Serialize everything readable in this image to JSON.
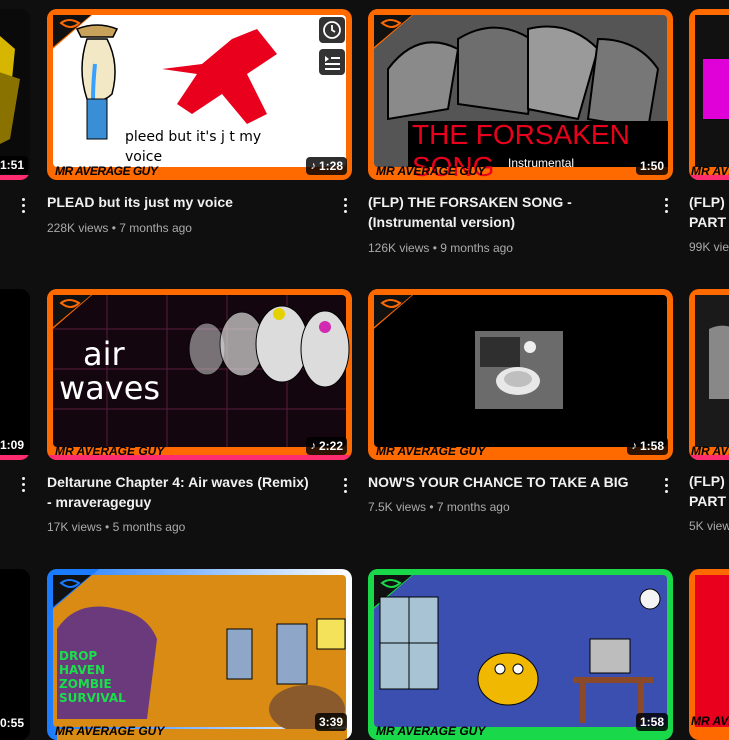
{
  "videos": [
    {
      "title": "PLEAD but its just my voice",
      "views": "228K views",
      "age": "7 months ago",
      "duration": "1:28",
      "thumb_text": "pleed but it's j t my voice",
      "channel_watermark": "MR AVERAGE GUY"
    },
    {
      "title": "(FLP) THE FORSAKEN SONG - (Instrumental version)",
      "views": "126K views",
      "age": "9 months ago",
      "duration": "1:50",
      "thumb_text": "THE FORSAKEN SONG",
      "thumb_sub": "Instrumental",
      "channel_watermark": "MR AVERAGE GUY"
    },
    {
      "title": "Deltarune Chapter 4: Air waves (Remix) - mraverageguy",
      "views": "17K views",
      "age": "5 months ago",
      "duration": "2:22",
      "thumb_text_1": "air",
      "thumb_text_2": "waves",
      "channel_watermark": "MR AVERAGE GUY"
    },
    {
      "title": "NOW'S YOUR CHANCE TO TAKE A BIG",
      "views": "7.5K views",
      "age": "7 months ago",
      "duration": "1:58",
      "channel_watermark": "MR AVERAGE GUY"
    },
    {
      "duration": "3:39",
      "thumb_text": "DROP HAVEN ZOMBIE SURVIVAL",
      "channel_watermark": "MR AVERAGE GUY"
    },
    {
      "duration": "1:58",
      "channel_watermark": "MR AVERAGE GUY"
    }
  ],
  "left_partial": {
    "durations": [
      "1:51",
      "1:09",
      "0:55"
    ]
  },
  "right_partial": {
    "rows": [
      {
        "title_1": "(FLP) r",
        "title_2": "PART :",
        "meta": "99K vie"
      },
      {
        "title_1": "(FLP) r",
        "title_2": "PART :",
        "meta": "5K view"
      }
    ],
    "watermark": "MR AVERAGE GU"
  },
  "separator": "•",
  "icons": {
    "watch_later": "clock-icon",
    "add_to_queue": "queue-icon",
    "more": "three-dot-menu-icon",
    "music_note": "music-note-icon"
  },
  "colors": {
    "background": "#0f0f0f",
    "title": "#f1f1f1",
    "meta": "#aaaaaa",
    "accent_orange": "#ff6a00"
  }
}
